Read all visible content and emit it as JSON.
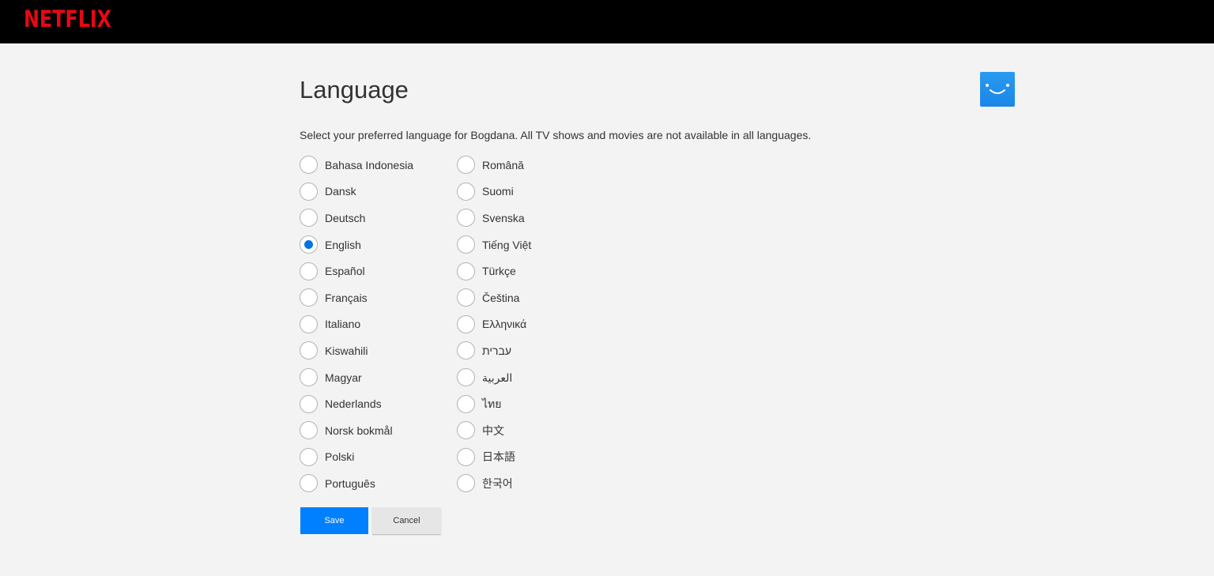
{
  "header": {
    "logo_text": "NETFLIX",
    "brand_color": "#e50914"
  },
  "page": {
    "title": "Language",
    "description": "Select your preferred language for Bogdana. All TV shows and movies are not available in all languages.",
    "avatar_icon": "smiley-profile-icon",
    "accent_color": "#0073e6"
  },
  "languages": {
    "left": [
      {
        "label": "Bahasa Indonesia",
        "checked": false
      },
      {
        "label": "Dansk",
        "checked": false
      },
      {
        "label": "Deutsch",
        "checked": false
      },
      {
        "label": "English",
        "checked": true
      },
      {
        "label": "Español",
        "checked": false
      },
      {
        "label": "Français",
        "checked": false
      },
      {
        "label": "Italiano",
        "checked": false
      },
      {
        "label": "Kiswahili",
        "checked": false
      },
      {
        "label": "Magyar",
        "checked": false
      },
      {
        "label": "Nederlands",
        "checked": false
      },
      {
        "label": "Norsk bokmål",
        "checked": false
      },
      {
        "label": "Polski",
        "checked": false
      },
      {
        "label": "Português",
        "checked": false
      }
    ],
    "right": [
      {
        "label": "Română",
        "checked": false
      },
      {
        "label": "Suomi",
        "checked": false
      },
      {
        "label": "Svenska",
        "checked": false
      },
      {
        "label": "Tiếng Việt",
        "checked": false
      },
      {
        "label": "Türkçe",
        "checked": false
      },
      {
        "label": "Čeština",
        "checked": false
      },
      {
        "label": "Ελληνικά",
        "checked": false
      },
      {
        "label": "עברית",
        "checked": false
      },
      {
        "label": "العربية",
        "checked": false
      },
      {
        "label": "ไทย",
        "checked": false
      },
      {
        "label": "中文",
        "checked": false
      },
      {
        "label": "日本語",
        "checked": false
      },
      {
        "label": "한국어",
        "checked": false
      }
    ]
  },
  "buttons": {
    "save_label": "Save",
    "cancel_label": "Cancel"
  }
}
